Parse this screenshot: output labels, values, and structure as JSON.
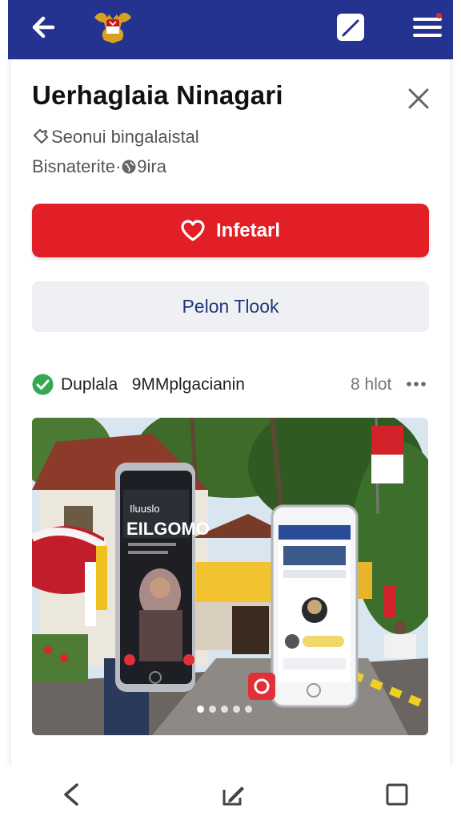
{
  "header": {
    "back_icon": "arrow-left-icon",
    "emblem_icon": "garuda-emblem-icon",
    "edit_icon": "edit-icon",
    "menu_icon": "hamburger-menu-icon",
    "background_color": "#24338f"
  },
  "card": {
    "title": "Uerhaglaia Ninagari",
    "close_icon": "close-icon",
    "subtitle_line1": "Seonui bingalaistal",
    "subtitle_line2_prefix": "Bisnaterite·",
    "subtitle_line2_suffix": "9ira"
  },
  "actions": {
    "primary_label": "Infetarl",
    "primary_icon": "heart-icon",
    "primary_color": "#e21f26",
    "secondary_label": "Pelon Tlook"
  },
  "post": {
    "verified_icon": "check-circle-icon",
    "author": "Duplala   9MMplgacianin",
    "meta": "8 hlot",
    "more_icon": "more-horizontal-icon",
    "image_screen_title_line1": "Iluuslo",
    "image_screen_title_line2": "EILGOMO",
    "carousel": {
      "count": 5,
      "active": 1
    }
  },
  "bottom_nav": {
    "back_icon": "chevron-left-icon",
    "compose_icon": "compose-icon",
    "square_icon": "square-icon"
  }
}
